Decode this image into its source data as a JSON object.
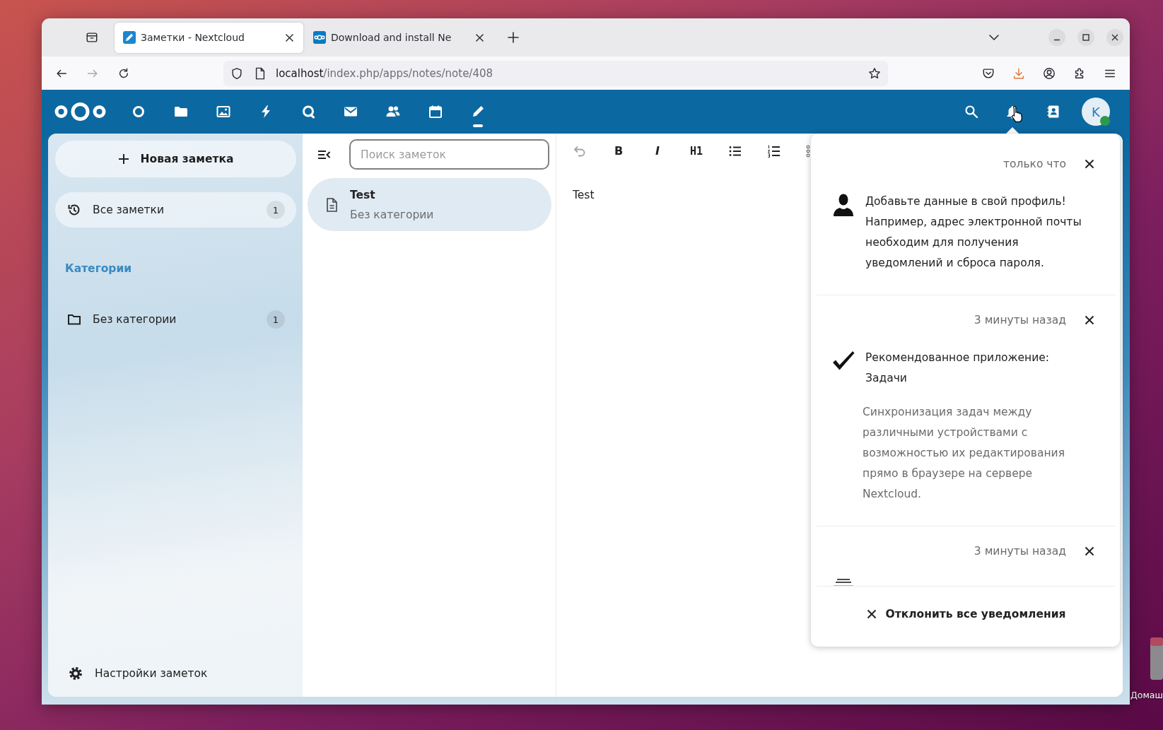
{
  "browser": {
    "tabs": [
      {
        "title": "Заметки - Nextcloud",
        "kind": "notes",
        "selected": true
      },
      {
        "title": "Download and install Ne",
        "kind": "site",
        "selected": false
      }
    ],
    "nav": [
      {
        "kind": "back",
        "disabled": false
      },
      {
        "kind": "forward",
        "disabled": true
      },
      {
        "kind": "reload",
        "disabled": false
      }
    ],
    "url": {
      "host": "localhost",
      "path": "/index.php/apps/notes/note/408"
    }
  },
  "header": {
    "apps": [
      {
        "kind": "dashboard",
        "selected": false
      },
      {
        "kind": "files",
        "selected": false
      },
      {
        "kind": "photos",
        "selected": false
      },
      {
        "kind": "activity",
        "selected": false
      },
      {
        "kind": "talk",
        "selected": false
      },
      {
        "kind": "mail",
        "selected": false
      },
      {
        "kind": "contacts",
        "selected": false
      },
      {
        "kind": "calendar",
        "selected": false
      },
      {
        "kind": "notes",
        "selected": true
      }
    ],
    "actions": [
      {
        "kind": "search",
        "expanded": false
      },
      {
        "kind": "notifications",
        "expanded": true
      },
      {
        "kind": "contacts-menu",
        "expanded": false
      }
    ],
    "avatar": {
      "initial": "K",
      "online": true
    }
  },
  "sidebar": {
    "new_note": "Новая заметка",
    "items": [
      {
        "label": "Все заметки",
        "count": "1",
        "selected": true
      }
    ],
    "categories_heading": "Категории",
    "categories": [
      {
        "label": "Без категории",
        "count": "1",
        "selected": false
      }
    ],
    "settings": "Настройки заметок"
  },
  "note_list": {
    "search_placeholder": "Поиск заметок",
    "notes": [
      {
        "title": "Test",
        "category": "Без категории",
        "selected": true
      }
    ]
  },
  "editor": {
    "toolbar": [
      {
        "kind": "undo",
        "disabled": true
      },
      {
        "kind": "bold",
        "label": "B",
        "disabled": false
      },
      {
        "kind": "italic",
        "label": "I",
        "disabled": false
      },
      {
        "kind": "heading",
        "label": "H1",
        "disabled": false
      },
      {
        "kind": "bullet-list",
        "disabled": false
      },
      {
        "kind": "numbered-list",
        "disabled": false
      },
      {
        "kind": "more",
        "disabled": false
      }
    ],
    "text": "Test"
  },
  "notifications": {
    "items": [
      {
        "kind": "profile",
        "time": "только что",
        "subject": "Добавьте данные в свой профиль! Например, адрес электронной почты необходим для получения уведомлений и сброса пароля."
      },
      {
        "kind": "app",
        "time": "3 минуты назад",
        "subject": "Рекомендованное приложение: Задачи",
        "message": "Синхронизация задач между различными устройствами с возможностью их редактирования прямо в браузере на сервере Nextcloud."
      },
      {
        "kind": "lines",
        "time": "3 минуты назад"
      }
    ],
    "dismiss_all": "Отклонить все уведомления"
  },
  "desktop": {
    "icons": [
      {
        "label": "Домаш"
      }
    ]
  }
}
